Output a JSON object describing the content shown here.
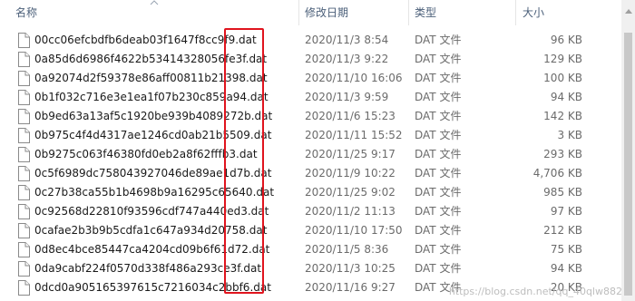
{
  "header": {
    "name": "名称",
    "date": "修改日期",
    "type": "类型",
    "size": "大小"
  },
  "files": [
    {
      "name": "00cc06efcbdfb6deab03f1647f8cc9f9.dat",
      "date": "2020/11/3 8:54",
      "type": "DAT 文件",
      "size": "96 KB"
    },
    {
      "name": "0a85d6d6986f4622b53414328056fe3f.dat",
      "date": "2020/11/3 9:22",
      "type": "DAT 文件",
      "size": "129 KB"
    },
    {
      "name": "0a92074d2f59378e86aff00811b21398.dat",
      "date": "2020/11/10 16:06",
      "type": "DAT 文件",
      "size": "100 KB"
    },
    {
      "name": "0b1f032c716e3e1ea1f07b230c859a94.dat",
      "date": "2020/11/3 9:59",
      "type": "DAT 文件",
      "size": "94 KB"
    },
    {
      "name": "0b9ed63a13af5c1920be939b4089272b.dat",
      "date": "2020/11/6 15:23",
      "type": "DAT 文件",
      "size": "142 KB"
    },
    {
      "name": "0b975c4f4d4317ae1246cd0ab21b5509.dat",
      "date": "2020/11/11 15:52",
      "type": "DAT 文件",
      "size": "3 KB"
    },
    {
      "name": "0b9275c063f46380fd0eb2a8f62fffb3.dat",
      "date": "2020/11/25 9:17",
      "type": "DAT 文件",
      "size": "293 KB"
    },
    {
      "name": "0c5f6989dc758043927046de89ae1d7b.dat",
      "date": "2020/11/9 10:22",
      "type": "DAT 文件",
      "size": "4,706 KB"
    },
    {
      "name": "0c27b38ca55b1b4698b9a16295c65640.dat",
      "date": "2020/11/25 9:02",
      "type": "DAT 文件",
      "size": "985 KB"
    },
    {
      "name": "0c92568d22810f93596cdf747a440ed3.dat",
      "date": "2020/11/2 11:13",
      "type": "DAT 文件",
      "size": "97 KB"
    },
    {
      "name": "0cafae2b3b9b5cdfa1c647a934d20758.dat",
      "date": "2020/11/10 17:50",
      "type": "DAT 文件",
      "size": "212 KB"
    },
    {
      "name": "0d8ec4bce85447ca4204cd09b6f61d72.dat",
      "date": "2020/11/5 8:36",
      "type": "DAT 文件",
      "size": "75 KB"
    },
    {
      "name": "0da9cabf224f0570d338f486a293ce3f.dat",
      "date": "2020/11/3 10:25",
      "type": "DAT 文件",
      "size": "94 KB"
    },
    {
      "name": "0dcd0a905165397615c7216034c2bbf6.dat",
      "date": "2020/11/16 9:27",
      "type": "DAT 文件",
      "size": "20 KB"
    }
  ],
  "watermark": "https://blog.csdn.net/qq_40qlw882",
  "colors": {
    "highlight_box": "#e0141e",
    "header_text": "#4c607a",
    "secondary_text": "#6b6b6b"
  },
  "icons": {
    "file": "file-icon",
    "sort": "sort-up-icon"
  }
}
